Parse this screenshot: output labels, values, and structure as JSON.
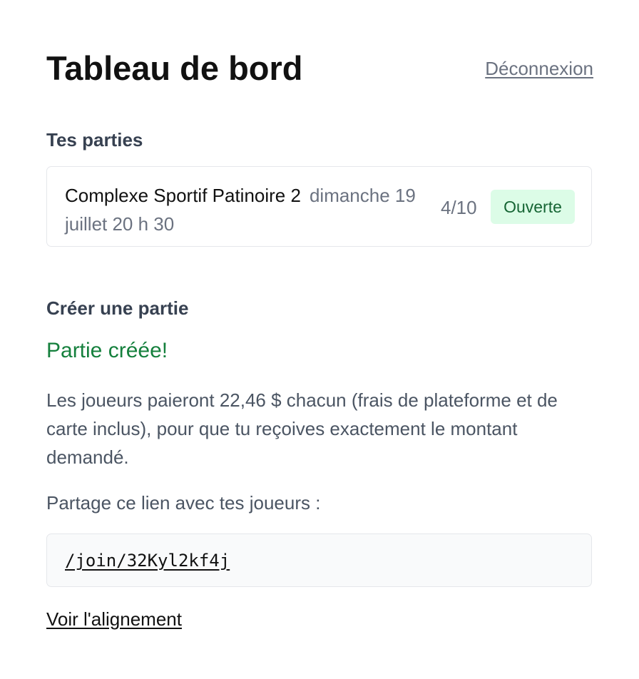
{
  "header": {
    "title": "Tableau de bord",
    "logout_label": "Déconnexion"
  },
  "games_section": {
    "label": "Tes parties",
    "games": [
      {
        "venue": "Complexe Sportif Patinoire 2",
        "datetime": "dimanche 19 juillet 20 h 30",
        "count": "4/10",
        "status": "Ouverte"
      }
    ]
  },
  "create_section": {
    "label": "Créer une partie",
    "success_message": "Partie créée!",
    "fee_text": "Les joueurs paieront 22,46 $ chacun (frais de plateforme et de carte inclus), pour que tu reçoives exactement le montant demandé.",
    "share_text": "Partage ce lien avec tes joueurs :",
    "join_link": "/join/32Kyl2kf4j",
    "lineup_link": "Voir l'alignement"
  },
  "colors": {
    "success": "#15803d",
    "badge_bg": "#dcfce7",
    "badge_text": "#166534",
    "muted": "#6b7280"
  }
}
